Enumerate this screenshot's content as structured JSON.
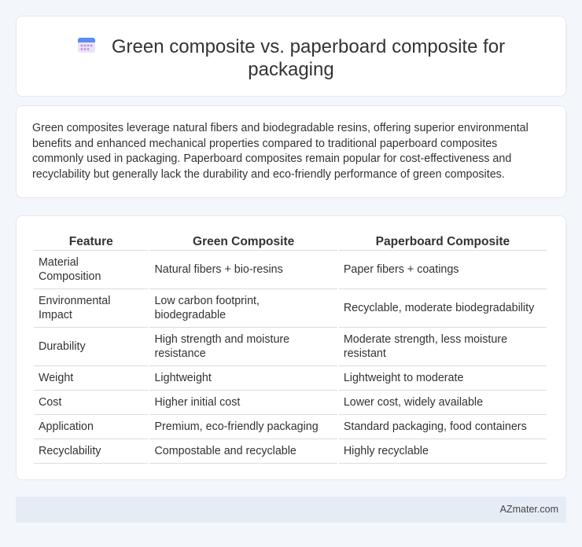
{
  "header": {
    "title_line1": "Green composite vs. paperboard composite for",
    "title_line2": "packaging",
    "icon": "calendar-icon"
  },
  "summary": {
    "text": "Green composites leverage natural fibers and biodegradable resins, offering superior environmental benefits and enhanced mechanical properties compared to traditional paperboard composites commonly used in packaging. Paperboard composites remain popular for cost-effectiveness and recyclability but generally lack the durability and eco-friendly performance of green composites."
  },
  "table": {
    "headers": [
      "Feature",
      "Green Composite",
      "Paperboard Composite"
    ],
    "rows": [
      [
        "Material Composition",
        "Natural fibers + bio-resins",
        "Paper fibers + coatings"
      ],
      [
        "Environmental Impact",
        "Low carbon footprint, biodegradable",
        "Recyclable, moderate biodegradability"
      ],
      [
        "Durability",
        "High strength and moisture resistance",
        "Moderate strength, less moisture resistant"
      ],
      [
        "Weight",
        "Lightweight",
        "Lightweight to moderate"
      ],
      [
        "Cost",
        "Higher initial cost",
        "Lower cost, widely available"
      ],
      [
        "Application",
        "Premium, eco-friendly packaging",
        "Standard packaging, food containers"
      ],
      [
        "Recyclability",
        "Compostable and recyclable",
        "Highly recyclable"
      ]
    ]
  },
  "footer": {
    "brand": "AZmater.com"
  },
  "colors": {
    "background": "#f3f6fb",
    "card": "#ffffff",
    "footer": "#e6ecf6",
    "icon_accent": "#5b8def"
  }
}
